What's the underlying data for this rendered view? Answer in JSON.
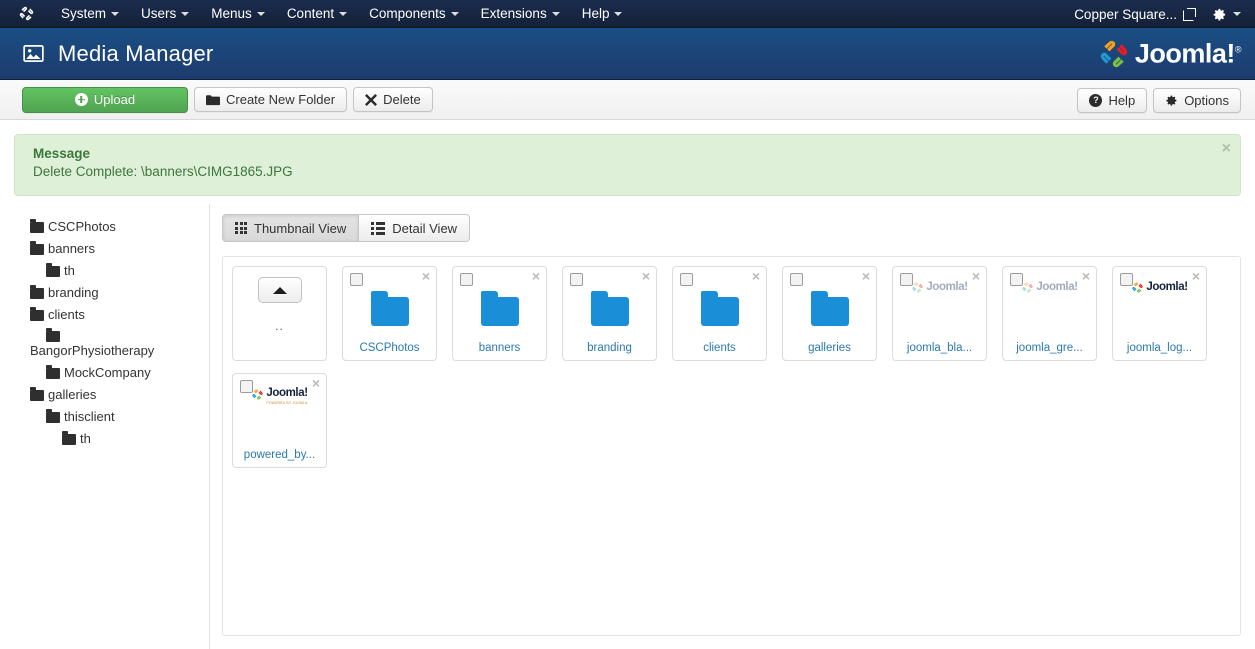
{
  "topbar": {
    "logo_icon": "joomla-mark-icon",
    "menu": [
      {
        "label": "System",
        "caret": true
      },
      {
        "label": "Users",
        "caret": true
      },
      {
        "label": "Menus",
        "caret": true
      },
      {
        "label": "Content",
        "caret": true
      },
      {
        "label": "Components",
        "caret": true
      },
      {
        "label": "Extensions",
        "caret": true
      },
      {
        "label": "Help",
        "caret": true
      }
    ],
    "site_name": "Copper Square...",
    "external_link_icon": "external-link-icon",
    "settings_icon": "gear-icon"
  },
  "header": {
    "icon": "image-icon",
    "title": "Media Manager",
    "brand": "Joomla!",
    "brand_reg": "®"
  },
  "toolbar": {
    "upload_label": "Upload",
    "upload_icon": "plus-circle-icon",
    "new_folder_label": "Create New Folder",
    "new_folder_icon": "folder-icon",
    "delete_label": "Delete",
    "delete_icon": "x-icon",
    "help_label": "Help",
    "help_icon": "question-circle-icon",
    "options_label": "Options",
    "options_icon": "gear-icon",
    "upload_color": "#51a351"
  },
  "message": {
    "title": "Message",
    "text": "Delete Complete: \\banners\\CIMG1865.JPG",
    "close_icon": "close-icon",
    "bg_color": "#dff0d8",
    "text_color": "#3c763d"
  },
  "sidebar": {
    "tree": [
      {
        "label": "CSCPhotos",
        "level": 0
      },
      {
        "label": "banners",
        "level": 0
      },
      {
        "label": "th",
        "level": 1
      },
      {
        "label": "branding",
        "level": 0
      },
      {
        "label": "clients",
        "level": 0
      },
      {
        "label": "BangorPhysiotherapy",
        "level": 1
      },
      {
        "label": "MockCompany",
        "level": 1
      },
      {
        "label": "galleries",
        "level": 0
      },
      {
        "label": "thisclient",
        "level": 1
      },
      {
        "label": "th",
        "level": 2
      }
    ]
  },
  "views": {
    "thumbnail_label": "Thumbnail View",
    "thumbnail_icon": "grid-icon",
    "detail_label": "Detail View",
    "detail_icon": "list-icon",
    "active": "thumbnail"
  },
  "files": {
    "up_label": "..",
    "up_icon": "chevron-up-icon",
    "items": [
      {
        "label": "CSCPhotos",
        "type": "folder"
      },
      {
        "label": "banners",
        "type": "folder"
      },
      {
        "label": "branding",
        "type": "folder"
      },
      {
        "label": "clients",
        "type": "folder"
      },
      {
        "label": "galleries",
        "type": "folder"
      },
      {
        "label": "joomla_bla...",
        "type": "image",
        "thumb": "joomla-logo-faded"
      },
      {
        "label": "joomla_gre...",
        "type": "image",
        "thumb": "joomla-logo-faded"
      },
      {
        "label": "joomla_log...",
        "type": "image",
        "thumb": "joomla-logo"
      },
      {
        "label": "powered_by...",
        "type": "image",
        "thumb": "joomla-logo-powered"
      }
    ],
    "folder_color": "#1a8fd8",
    "label_color": "#2a7ab0"
  }
}
